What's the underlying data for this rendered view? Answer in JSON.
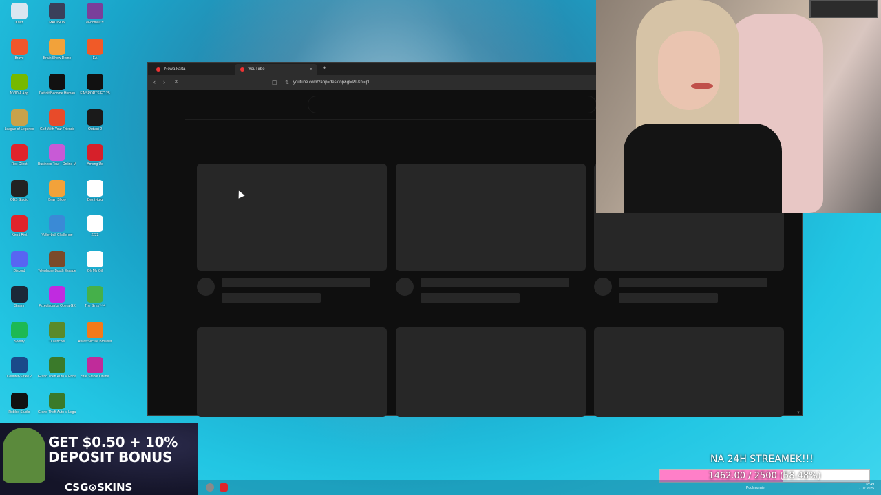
{
  "desktop": {
    "icons": [
      {
        "label": "Kosz",
        "icon": "recycle-bin-icon",
        "color": "#d9e6f0"
      },
      {
        "label": "MADISON",
        "icon": "game-icon",
        "color": "#3a3f5a"
      },
      {
        "label": "eFootball™",
        "icon": "game-icon",
        "color": "#7a3f9a"
      },
      {
        "label": "Brave",
        "icon": "brave-icon",
        "color": "#f1562b"
      },
      {
        "label": "Brain Show Demo",
        "icon": "game-icon",
        "color": "#f2a23a"
      },
      {
        "label": "EA",
        "icon": "ea-icon",
        "color": "#f05a28"
      },
      {
        "label": "NVIDIA App",
        "icon": "nvidia-icon",
        "color": "#76b900"
      },
      {
        "label": "Detroit Become Human",
        "icon": "game-icon",
        "color": "#111111"
      },
      {
        "label": "EA SPORTS FC 25",
        "icon": "game-icon",
        "color": "#111111"
      },
      {
        "label": "League of Legends",
        "icon": "game-icon",
        "color": "#c8a24a"
      },
      {
        "label": "Golf With Your Friends",
        "icon": "game-icon",
        "color": "#e84b2a"
      },
      {
        "label": "Outlast 2",
        "icon": "game-icon",
        "color": "#1a1a1a"
      },
      {
        "label": "Riot Client",
        "icon": "riot-icon",
        "color": "#e0242b"
      },
      {
        "label": "Business Tour - Online Multipla...",
        "icon": "game-icon",
        "color": "#c85ad6"
      },
      {
        "label": "Among Us",
        "icon": "game-icon",
        "color": "#d6202a"
      },
      {
        "label": "OBS Studio",
        "icon": "obs-icon",
        "color": "#222222"
      },
      {
        "label": "Brain Show",
        "icon": "game-icon",
        "color": "#f2a23a"
      },
      {
        "label": "Bez tytułu",
        "icon": "file-icon",
        "color": "#ffffff"
      },
      {
        "label": "Klient Riot",
        "icon": "riot-icon",
        "color": "#e0242b"
      },
      {
        "label": "Volleyball Challenge",
        "icon": "game-icon",
        "color": "#3a8ad6"
      },
      {
        "label": "2222",
        "icon": "file-icon",
        "color": "#ffffff"
      },
      {
        "label": "Discord",
        "icon": "discord-icon",
        "color": "#5865f2"
      },
      {
        "label": "Telephone Booth Escape From Hell",
        "icon": "game-icon",
        "color": "#7a4a2a"
      },
      {
        "label": "Oh My Gif",
        "icon": "game-icon",
        "color": "#ffffff"
      },
      {
        "label": "Steam",
        "icon": "steam-icon",
        "color": "#1b2838"
      },
      {
        "label": "Przeglądarka Opera GX",
        "icon": "opera-icon",
        "color": "#c02be0"
      },
      {
        "label": "The Sims™ 4",
        "icon": "game-icon",
        "color": "#45b04a"
      },
      {
        "label": "Spotify",
        "icon": "spotify-icon",
        "color": "#1db954"
      },
      {
        "label": "TLauncher",
        "icon": "minecraft-icon",
        "color": "#5a8a2a"
      },
      {
        "label": "Avast Secure Browser",
        "icon": "browser-icon",
        "color": "#f27a1a"
      },
      {
        "label": "Counter-Strike 2",
        "icon": "game-icon",
        "color": "#1a4a8a"
      },
      {
        "label": "Grand Theft Auto V Enhanced",
        "icon": "gta-icon",
        "color": "#3a7a2a"
      },
      {
        "label": "Star Stable Online",
        "icon": "game-icon",
        "color": "#c02b9a"
      },
      {
        "label": "Roblox Studio",
        "icon": "roblox-icon",
        "color": "#111111"
      },
      {
        "label": "Grand Theft Auto V Legacy",
        "icon": "gta-icon",
        "color": "#3a7a2a"
      }
    ]
  },
  "browser": {
    "tabs": [
      {
        "label": "Nowa karta",
        "active": false
      },
      {
        "label": "YouTube",
        "active": true
      }
    ],
    "new_tab_glyph": "+",
    "address": "youtube.com/?app=desktop&gl=PL&hl=pl",
    "back_glyph": "‹",
    "forward_glyph": "›",
    "stop_glyph": "✕",
    "bookmark_glyph": "☐",
    "site_info_glyph": "⇅",
    "scroll_glyph": "▼"
  },
  "overlay": {
    "promo_headline": "GET $0.50 + 10% DEPOSIT BONUS",
    "promo_brand": "CSG⊙SKINS",
    "goal_title": "NA 24H STREAMEK!!!",
    "goal_text": "1462.00 / 2500 (58.48%)",
    "goal_progress": 0.5848,
    "accent_pink": "#ff7fc8"
  },
  "taskbar": {
    "tray_label": "Pochmurnie",
    "clock_time": "18:49",
    "clock_date": "7.02.2025"
  }
}
